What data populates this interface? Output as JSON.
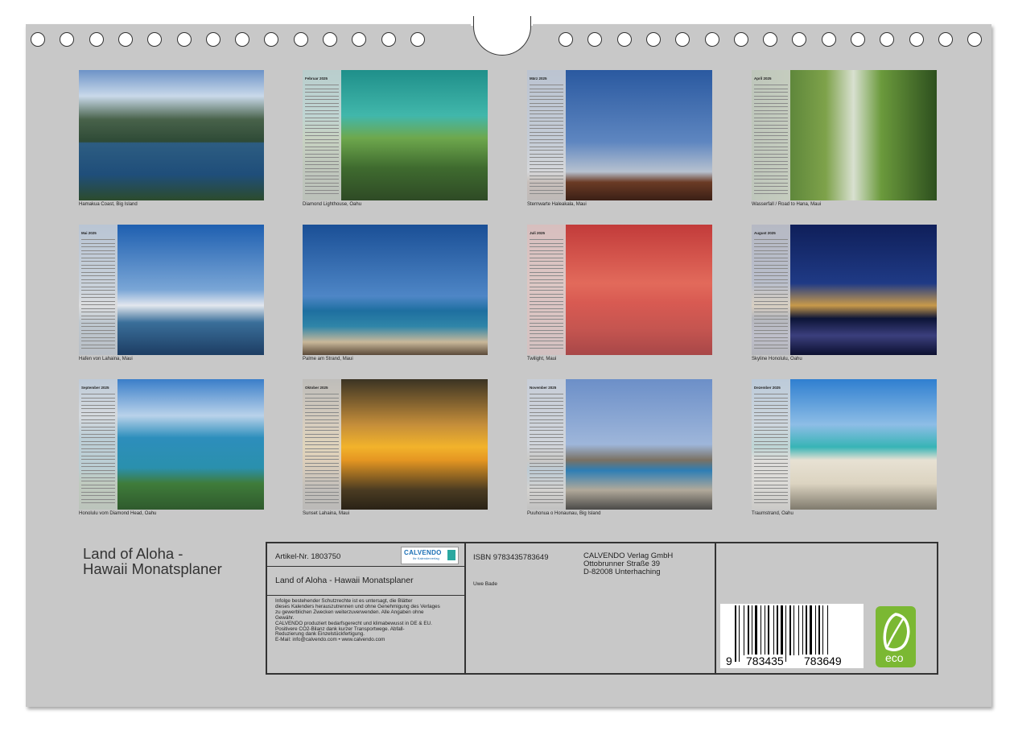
{
  "months": [
    {
      "caption": "Hamakua Coast, Big Island",
      "month": ""
    },
    {
      "caption": "Diamond Lighthouse, Oahu",
      "month": "Februar 2025"
    },
    {
      "caption": "Sternwarte Haleakala, Maui",
      "month": "März 2025"
    },
    {
      "caption": "Wasserfall / Road to Hana, Maui",
      "month": "April 2025"
    },
    {
      "caption": "Hafen von Lahaina, Maui",
      "month": "Mai 2025"
    },
    {
      "caption": "Palme am Strand, Maui",
      "month": ""
    },
    {
      "caption": "Twilight, Maui",
      "month": "Juli 2025"
    },
    {
      "caption": "Skyline Honolulu, Oahu",
      "month": "August 2025"
    },
    {
      "caption": "Honolulu vom Diamond Head, Oahu",
      "month": "September 2025"
    },
    {
      "caption": "Sunset Lahaina, Maui",
      "month": "Oktober 2025"
    },
    {
      "caption": "Puuhonua o Honaunau, Big Island",
      "month": "November 2025"
    },
    {
      "caption": "Traumstrand, Oahu",
      "month": "Dezember 2025"
    }
  ],
  "title": {
    "line1": "Land of Aloha -",
    "line2": "Hawaii Monatsplaner"
  },
  "info": {
    "article": "Artikel-Nr. 1803750",
    "logo": "CALVENDO",
    "logo_sub": "Ihr Kalenderverlag",
    "product_title": "Land of Aloha - Hawaii Monatsplaner",
    "legal": [
      "Infolge bestehender Schutzrechte ist es untersagt, die Blätter",
      "dieses Kalenders herauszutrennen und ohne Genehmigung des Verlages",
      "zu gewerblichen Zwecken weiterzuverwenden. Alle Angaben ohne",
      "Gewähr.",
      "CALVENDO produziert bedarfsgerecht und klimabewusst in DE & EU.",
      "Positivere CO2-Bilanz dank kurzer Transportwege. Abfall-",
      "Reduzierung dank Einzelstückfertigung.",
      "E-Mail: info@calvendo.com • www.calvendo.com"
    ],
    "isbn": "ISBN 9783435783649",
    "author": "Uwe Bade",
    "publisher": [
      "CALVENDO Verlag GmbH",
      "Ottobrunner Straße 39",
      "D-82008 Unterhaching"
    ],
    "barcode": {
      "first": "9",
      "group1": "783435",
      "group2": "783649"
    },
    "eco_label": "eco"
  },
  "colors": {
    "page": "#c8c8c8",
    "border": "#333333",
    "eco": "#7bb833",
    "logo": "#1b6fb5"
  }
}
